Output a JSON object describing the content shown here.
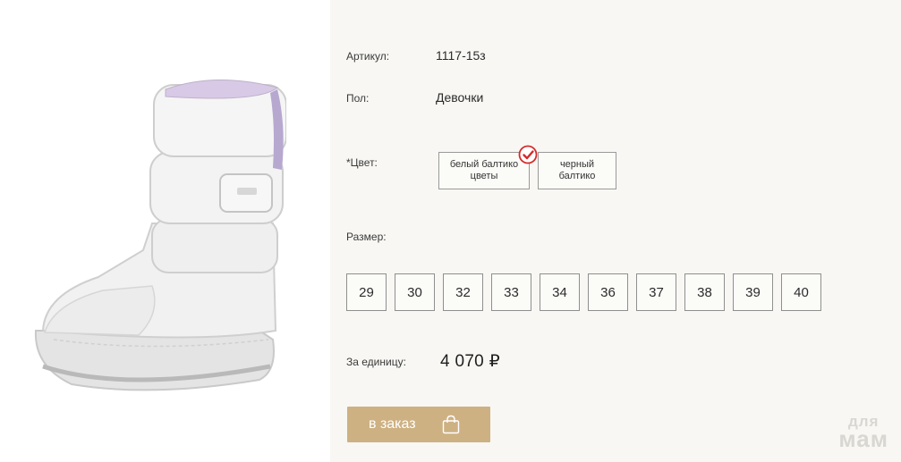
{
  "product": {
    "image_alt": "boot-image",
    "article_label": "Артикул:",
    "article_value": "1117-15з",
    "gender_label": "Пол:",
    "gender_value": "Девочки",
    "color_label": "*Цвет:",
    "colors": [
      {
        "label": "белый балтико цветы",
        "selected": true
      },
      {
        "label": "черный балтико",
        "selected": false
      }
    ],
    "size_label": "Размер:",
    "sizes": [
      "29",
      "30",
      "32",
      "33",
      "34",
      "36",
      "37",
      "38",
      "39",
      "40"
    ],
    "price_label": "За единицу:",
    "price_value": "4 070 ₽",
    "order_label": "в заказ"
  },
  "watermark": {
    "line1": "для",
    "line2": "мам"
  },
  "colors": {
    "accent": "#ceb183",
    "check": "#d62a2a",
    "panel_bg": "#f8f7f3"
  }
}
